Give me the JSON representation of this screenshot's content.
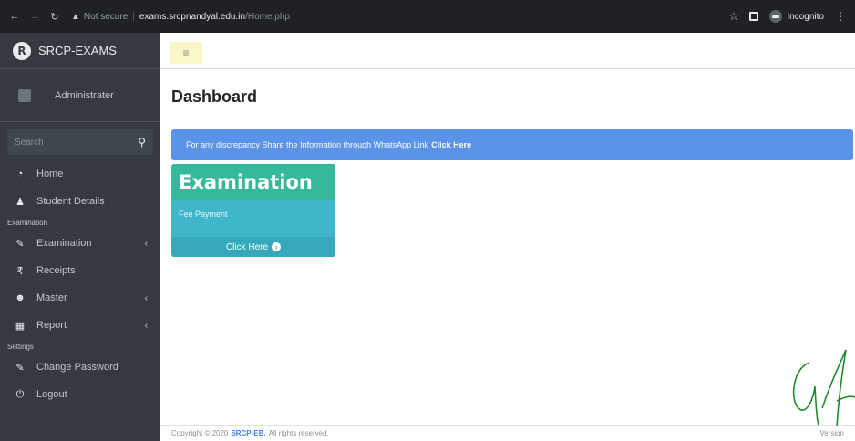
{
  "browser": {
    "not_secure": "Not secure",
    "url_host": "exams.srcpnandyal.edu.in",
    "url_path": "/Home.php",
    "incognito": "Incognito"
  },
  "sidebar": {
    "brand": "SRCP-EXAMS",
    "user": "Administrater",
    "search_placeholder": "Search",
    "items": [
      {
        "label": "Home",
        "icon": "dashboard-icon"
      },
      {
        "label": "Student Details",
        "icon": "user-icon"
      },
      {
        "label": "Examination",
        "icon": "edit-icon"
      },
      {
        "label": "Receipts",
        "icon": "rupee-icon"
      },
      {
        "label": "Master",
        "icon": "users-icon"
      },
      {
        "label": "Report",
        "icon": "table-icon"
      },
      {
        "label": "Change Password",
        "icon": "edit-icon"
      },
      {
        "label": "Logout",
        "icon": "power-icon"
      }
    ],
    "headers": {
      "examination": "Examination",
      "settings": "Settings"
    }
  },
  "main": {
    "title": "Dashboard",
    "alert_text": "For any discrepancy Share the Information through WhatsApp Link",
    "alert_link": "Click Here",
    "card": {
      "title": "Examination",
      "subtitle": "Fee Payment",
      "footer": "Click Here"
    }
  },
  "footer": {
    "prefix": "Copyright © 2020",
    "brand": "SRCP-EB.",
    "suffix": "All rights reserved.",
    "right": "Version"
  },
  "colors": {
    "sidebar": "#343a40",
    "alert": "#5b93e8",
    "card": "#3fb6c9",
    "card_header": "#36b89a"
  }
}
